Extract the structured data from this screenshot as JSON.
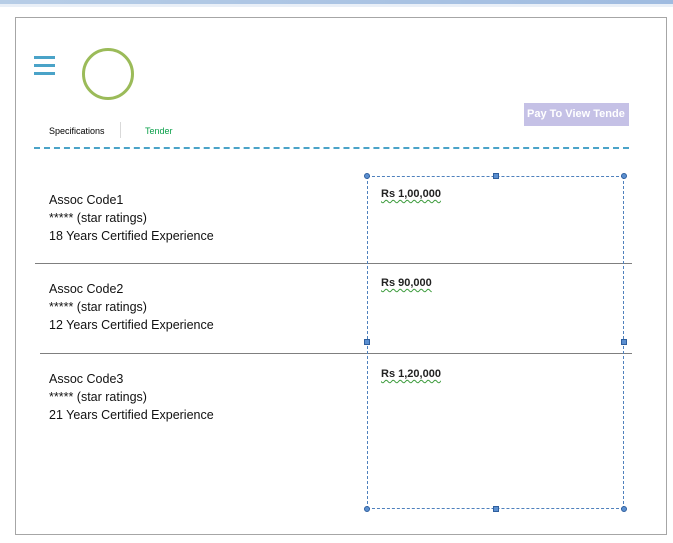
{
  "header": {
    "tabs": [
      {
        "label": "Specifications"
      },
      {
        "label": "Tender"
      }
    ],
    "pay_button_label": "Pay To View Tende"
  },
  "icons": {
    "menu": "hamburger-menu-icon",
    "logo": "circle-logo-icon"
  },
  "colors": {
    "accent": "#4aa3c8",
    "logo_ring": "#9bbb59",
    "tender_tab": "#0ba04a",
    "pay_button": "#c5c1e6"
  },
  "associates": [
    {
      "code": "Assoc Code1",
      "rating": "***** (star ratings)",
      "experience": "18 Years Certified Experience",
      "price": "Rs 1,00,000"
    },
    {
      "code": "Assoc Code2",
      "rating": "***** (star ratings)",
      "experience": "12 Years Certified Experience",
      "price": "Rs 90,000"
    },
    {
      "code": "Assoc Code3",
      "rating": "***** (star ratings)",
      "experience": "21 Years Certified Experience",
      "price": "Rs 1,20,000"
    }
  ]
}
